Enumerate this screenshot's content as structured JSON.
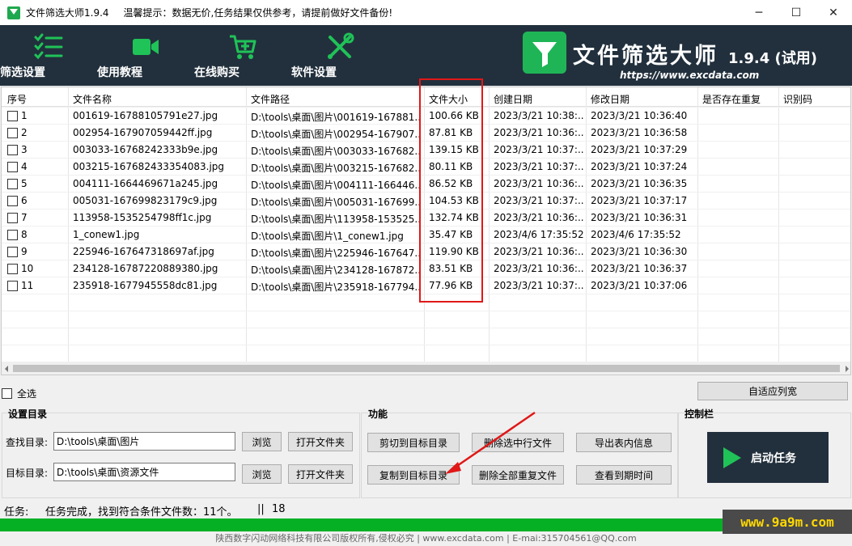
{
  "window": {
    "title": "文件筛选大师1.9.4",
    "hint": "温馨提示：数据无价,任务结果仅供参考，请提前做好文件备份!",
    "minimize": "─",
    "maximize": "☐",
    "close": "✕"
  },
  "toolbar": [
    {
      "label": "筛选设置",
      "icon": "checklist-icon"
    },
    {
      "label": "使用教程",
      "icon": "video-camera-icon"
    },
    {
      "label": "在线购买",
      "icon": "shopping-cart-icon"
    },
    {
      "label": "软件设置",
      "icon": "tools-icon"
    }
  ],
  "brand": {
    "name": "文件筛选大师",
    "version": "1.9.4 (试用)",
    "url": "https://www.excdata.com",
    "accent": "#1fb557"
  },
  "table": {
    "columns": [
      "序号",
      "文件名称",
      "文件路径",
      "文件大小",
      "创建日期",
      "修改日期",
      "是否存在重复",
      "识别码"
    ],
    "rows": [
      {
        "no": "1",
        "name": "001619-16788105791e27.jpg",
        "path": "D:\\tools\\桌面\\图片\\001619-167881...",
        "size": "100.66 KB",
        "created": "2023/3/21 10:38:...",
        "modified": "2023/3/21 10:36:40"
      },
      {
        "no": "2",
        "name": "002954-167907059442ff.jpg",
        "path": "D:\\tools\\桌面\\图片\\002954-167907...",
        "size": "87.81 KB",
        "created": "2023/3/21 10:36:...",
        "modified": "2023/3/21 10:36:58"
      },
      {
        "no": "3",
        "name": "003033-16768242333b9e.jpg",
        "path": "D:\\tools\\桌面\\图片\\003033-167682...",
        "size": "139.15 KB",
        "created": "2023/3/21 10:37:...",
        "modified": "2023/3/21 10:37:29"
      },
      {
        "no": "4",
        "name": "003215-167682433354083.jpg",
        "path": "D:\\tools\\桌面\\图片\\003215-167682...",
        "size": "80.11 KB",
        "created": "2023/3/21 10:37:...",
        "modified": "2023/3/21 10:37:24"
      },
      {
        "no": "5",
        "name": "004111-1664469671a245.jpg",
        "path": "D:\\tools\\桌面\\图片\\004111-166446...",
        "size": "86.52 KB",
        "created": "2023/3/21 10:36:...",
        "modified": "2023/3/21 10:36:35"
      },
      {
        "no": "6",
        "name": "005031-167699823179c9.jpg",
        "path": "D:\\tools\\桌面\\图片\\005031-167699...",
        "size": "104.53 KB",
        "created": "2023/3/21 10:37:...",
        "modified": "2023/3/21 10:37:17"
      },
      {
        "no": "7",
        "name": "113958-1535254798ff1c.jpg",
        "path": "D:\\tools\\桌面\\图片\\113958-153525...",
        "size": "132.74 KB",
        "created": "2023/3/21 10:36:...",
        "modified": "2023/3/21 10:36:31"
      },
      {
        "no": "8",
        "name": "1_conew1.jpg",
        "path": "D:\\tools\\桌面\\图片\\1_conew1.jpg",
        "size": "35.47 KB",
        "created": "2023/4/6 17:35:52",
        "modified": "2023/4/6 17:35:52"
      },
      {
        "no": "9",
        "name": "225946-167647318697af.jpg",
        "path": "D:\\tools\\桌面\\图片\\225946-167647...",
        "size": "119.90 KB",
        "created": "2023/3/21 10:36:...",
        "modified": "2023/3/21 10:36:30"
      },
      {
        "no": "10",
        "name": "234128-16787220889380.jpg",
        "path": "D:\\tools\\桌面\\图片\\234128-167872...",
        "size": "83.51 KB",
        "created": "2023/3/21 10:36:...",
        "modified": "2023/3/21 10:36:37"
      },
      {
        "no": "11",
        "name": "235918-1677945558dc81.jpg",
        "path": "D:\\tools\\桌面\\图片\\235918-167794...",
        "size": "77.96 KB",
        "created": "2023/3/21 10:37:...",
        "modified": "2023/3/21 10:37:06"
      }
    ]
  },
  "select_all": "全选",
  "autofit_button": "自适应列宽",
  "dir_group": {
    "title": "设置目录",
    "find_label": "查找目录:",
    "find_value": "D:\\tools\\桌面\\图片",
    "target_label": "目标目录:",
    "target_value": "D:\\tools\\桌面\\资源文件",
    "browse": "浏览",
    "open_folder": "打开文件夹"
  },
  "func_group": {
    "title": "功能",
    "cut": "剪切到目标目录",
    "delete_selected": "删除选中行文件",
    "export": "导出表内信息",
    "copy": "复制到目标目录",
    "delete_dups": "删除全部重复文件",
    "expire": "查看到期时间"
  },
  "control_group": {
    "title": "控制栏",
    "start": "启动任务"
  },
  "status": {
    "label": "任务:",
    "message": "任务完成，找到符合条件文件数：11个。",
    "sep": "||",
    "count": "18",
    "progress": 1.0
  },
  "footer": "陕西数字闪动网络科技有限公司版权所有,侵权必究 | www.excdata.com | E-mai:315704561@QQ.com",
  "watermark": "www.9a9m.com"
}
